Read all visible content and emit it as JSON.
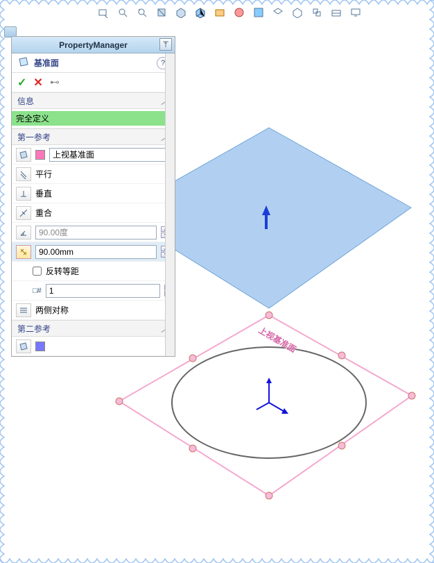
{
  "header": {
    "title": "PropertyManager"
  },
  "feature": {
    "name": "基准面"
  },
  "sections": {
    "info": {
      "label": "信息",
      "status": "完全定义"
    },
    "ref1": {
      "label": "第一参考",
      "entity": "上视基准面",
      "parallel": "平行",
      "perpendicular": "垂直",
      "coincident": "重合",
      "angle": "90.00度",
      "distance": "90.00mm",
      "reverse": "反转等距",
      "instances": "1",
      "symmetric": "两侧对称"
    },
    "ref2": {
      "label": "第二参考"
    }
  },
  "scene": {
    "plane_label": "上视基准面"
  }
}
